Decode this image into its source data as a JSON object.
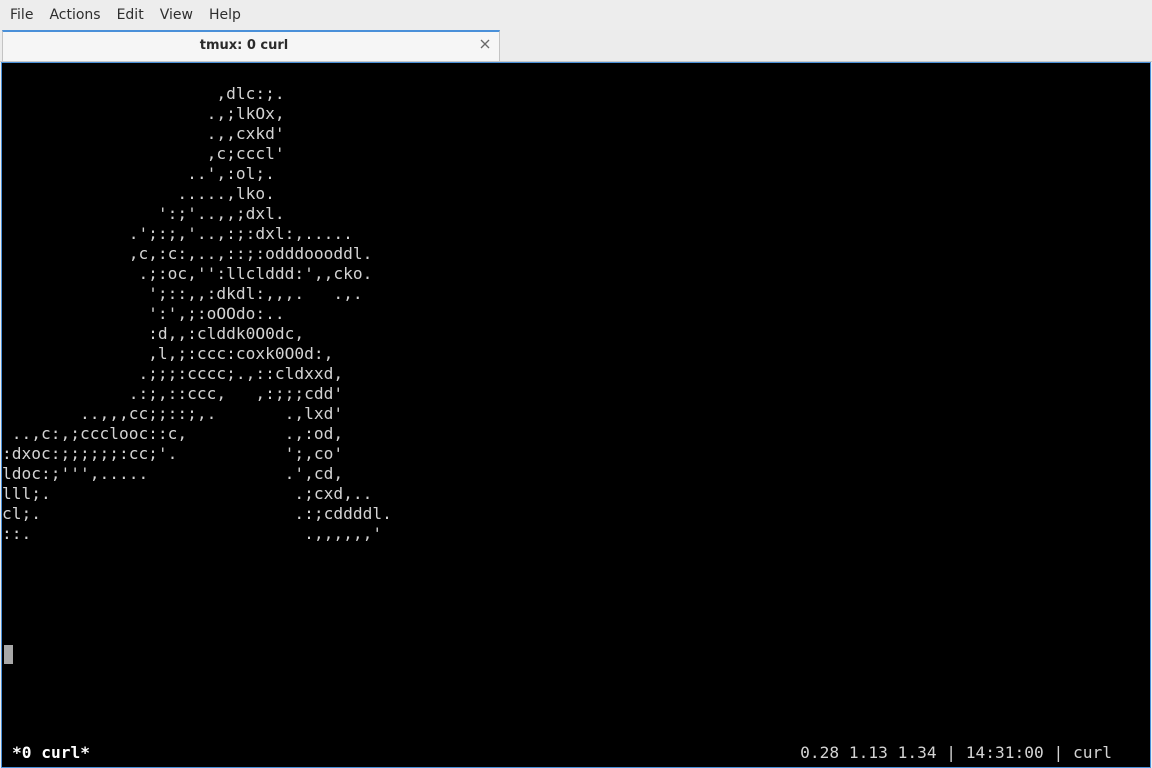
{
  "menubar": {
    "items": [
      "File",
      "Actions",
      "Edit",
      "View",
      "Help"
    ]
  },
  "tab": {
    "title": "tmux: 0 curl",
    "close_icon": "close-icon"
  },
  "terminal": {
    "ascii_art": "                      ,dlc:;.\n                     .,;lkOx,\n                     .,,cxkd'\n                     ,c;cccl'\n                   ..',:ol;.\n                  .....,lko.\n                ':;'..,,;dxl.\n             .';:;,'..,:;:dxl:,.....\n             ,c,:c:,..,::;:odddoooddl.\n              .;:oc,'':llclddd:',,cko.\n               ';::,,:dkdl:,,,.   .,.\n               ':',;:oOOdo:..\n               :d,,:clddk0O0dc,\n               ,l,;:ccc:coxk0O0d:,\n              .;;;:cccc;.,::cldxxd,\n             .:;,::ccc,   ,:;;;cdd'\n        ..,,,cc;;::;,.       .,lxd'\n ..,c:,;ccclooc::c,          .,:od,\n:dxoc:;;;;;;:cc;'.           ';,co'\nldoc:;''',.....              .',cd,\nlll;.                         .;cxd,..\ncl;.                          .:;cddddl.\n::.                            .,,,,,,'",
    "status_left": "*0 curl*",
    "status_right": "0.28 1.13 1.34 | 14:31:00 | curl"
  },
  "colors": {
    "terminal_bg": "#000000",
    "terminal_fg": "#d3d3d3",
    "accent": "#4a90d9",
    "chrome_bg": "#ededed"
  }
}
